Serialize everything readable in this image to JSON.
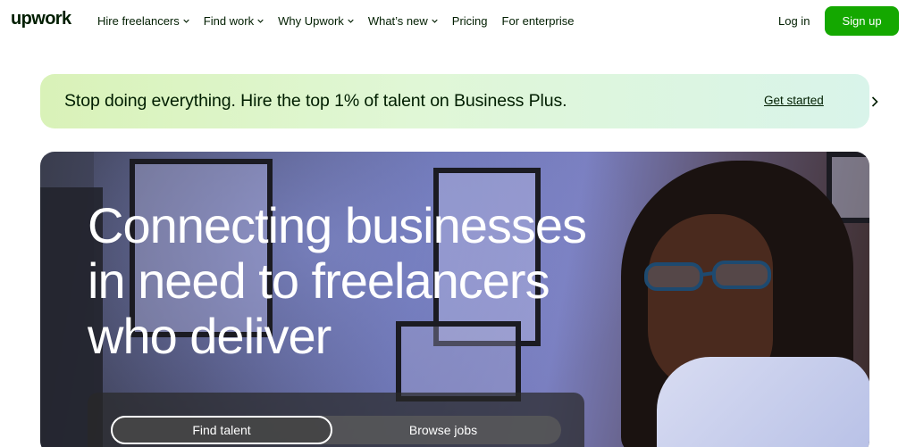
{
  "header": {
    "logo": "upwork",
    "nav": [
      {
        "label": "Hire freelancers",
        "has_menu": true
      },
      {
        "label": "Find work",
        "has_menu": true
      },
      {
        "label": "Why Upwork",
        "has_menu": true
      },
      {
        "label": "What’s new",
        "has_menu": true
      },
      {
        "label": "Pricing",
        "has_menu": false
      },
      {
        "label": "For enterprise",
        "has_menu": false
      }
    ],
    "login": "Log in",
    "signup": "Sign up"
  },
  "banner": {
    "text": "Stop doing everything. Hire the top 1% of talent on Business Plus.",
    "link": "Get started",
    "icon": "chevron-right-icon"
  },
  "hero": {
    "title_lines": [
      "Connecting businesses",
      "in need to freelancers",
      "who deliver"
    ],
    "tabs": [
      {
        "label": "Find talent",
        "active": true
      },
      {
        "label": "Browse jobs",
        "active": false
      }
    ]
  },
  "colors": {
    "brand_green": "#14a800",
    "text": "#001e00",
    "banner_gradient_start": "#d9f2b8",
    "banner_gradient_end": "#d9f4ea"
  }
}
